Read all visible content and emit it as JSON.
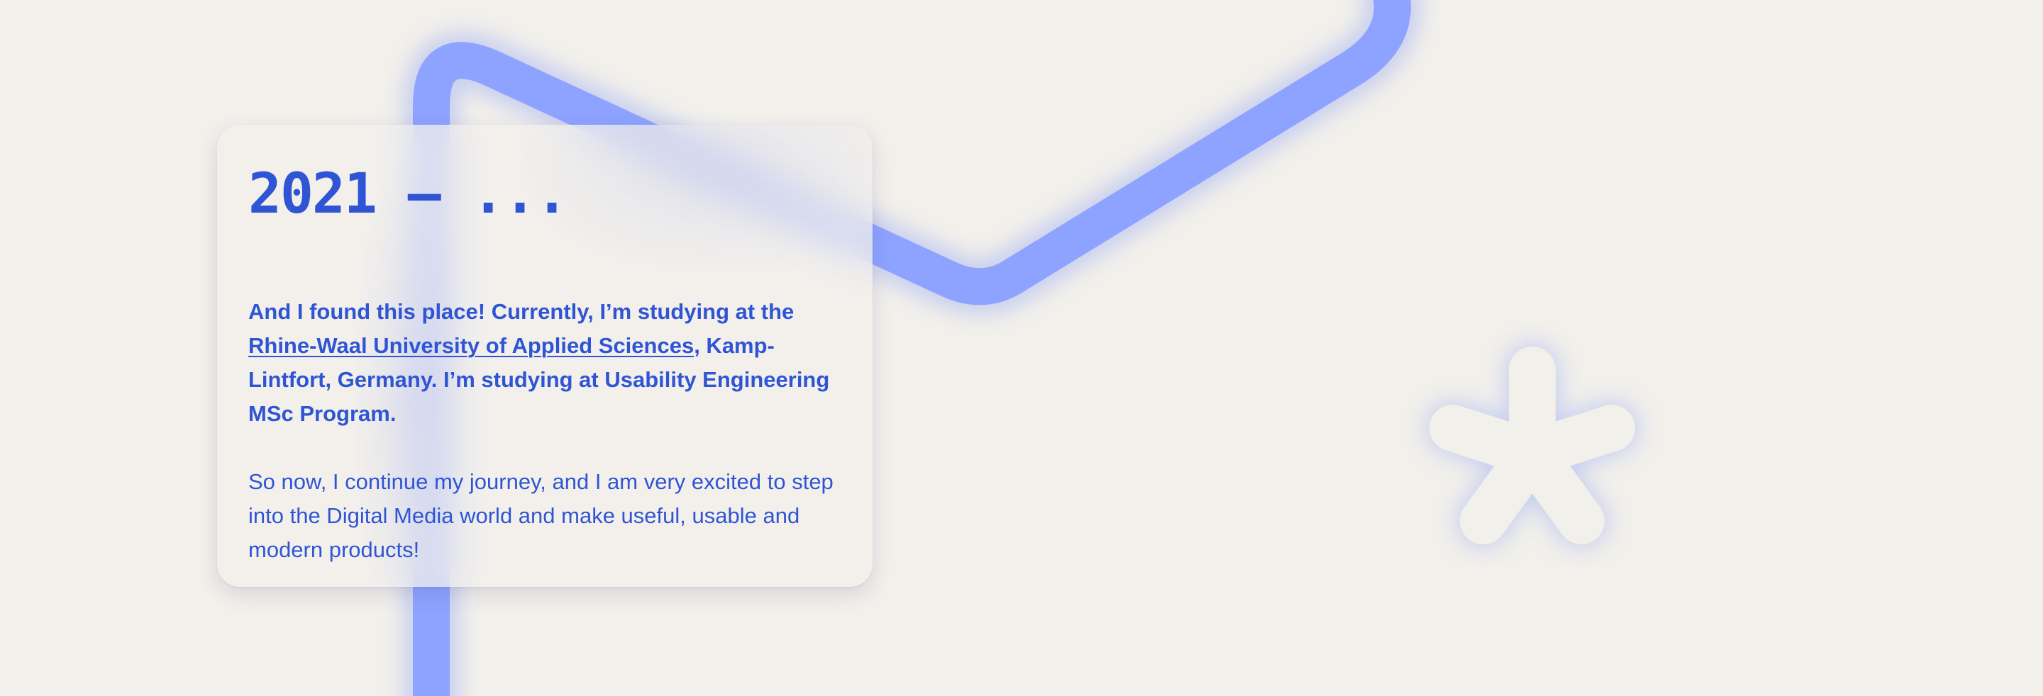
{
  "colors": {
    "background": "#f2f0eb",
    "accent": "#2f55d4",
    "line": "#8da3ff",
    "glow": "#a9b6f2"
  },
  "icons": {
    "decoration": "asterisk-shape-icon"
  },
  "timeline": {
    "year": "2021 – ...",
    "intro_before_link": "And I found this place! Currently, I’m studying at the ",
    "university_link": "Rhine-Waal University of Applied Sciences",
    "intro_after_link": ", Kamp-Lintfort, Germany. I’m studying at Usability Engineering MSc Program.",
    "outro": "So now, I continue my journey, and I am very excited to step into the Digital Media world and make useful, usable and modern products!"
  }
}
